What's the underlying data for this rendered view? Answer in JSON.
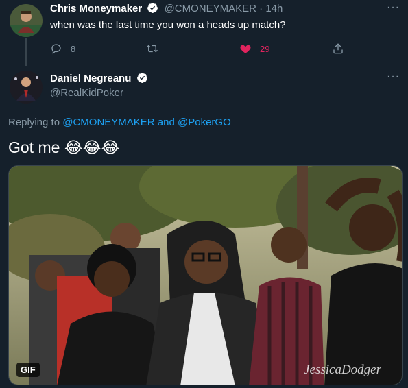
{
  "tweet1": {
    "display_name": "Chris Moneymaker",
    "handle": "@CMONEYMAKER",
    "separator": " · ",
    "time": "14h",
    "text": "when was the last time you won a heads up match?",
    "reply_count": "8",
    "retweet_count": "",
    "like_count": "29",
    "liked": true
  },
  "tweet2": {
    "display_name": "Daniel Negreanu",
    "handle": "@RealKidPoker",
    "replying_prefix": "Replying to ",
    "replying_user1": "@CMONEYMAKER",
    "replying_and": " and ",
    "replying_user2": "@PokerGO",
    "text": "Got me 😂😂😂",
    "media": {
      "badge": "GIF",
      "watermark": "JessicaDodger"
    }
  },
  "icons": {
    "verified": "verified-badge-icon",
    "more": "more-options-icon",
    "reply": "reply-icon",
    "retweet": "retweet-icon",
    "like": "heart-icon",
    "share": "share-icon"
  },
  "colors": {
    "background": "#15202b",
    "text_secondary": "#8899a6",
    "link": "#1da1f2",
    "like": "#e0245e",
    "border": "#38444d"
  },
  "ui": {
    "more_glyph": "···"
  }
}
